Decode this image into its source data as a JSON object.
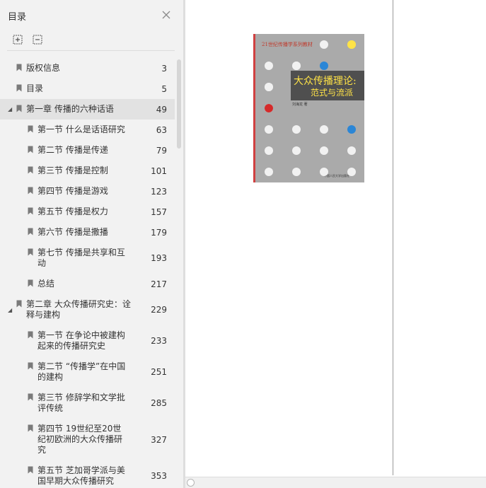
{
  "toc": {
    "title": "目录",
    "items": [
      {
        "label": "版权信息",
        "page": "3",
        "level": 1,
        "caret": "",
        "selected": false
      },
      {
        "label": "目录",
        "page": "5",
        "level": 1,
        "caret": "",
        "selected": false
      },
      {
        "label": "第一章 传播的六种话语",
        "page": "49",
        "level": 1,
        "caret": "◢",
        "selected": true
      },
      {
        "label": "第一节 什么是话语研究",
        "page": "63",
        "level": 2,
        "caret": "",
        "selected": false
      },
      {
        "label": "第二节 传播是传递",
        "page": "79",
        "level": 2,
        "caret": "",
        "selected": false
      },
      {
        "label": "第三节 传播是控制",
        "page": "101",
        "level": 2,
        "caret": "",
        "selected": false
      },
      {
        "label": "第四节 传播是游戏",
        "page": "123",
        "level": 2,
        "caret": "",
        "selected": false
      },
      {
        "label": "第五节 传播是权力",
        "page": "157",
        "level": 2,
        "caret": "",
        "selected": false
      },
      {
        "label": "第六节 传播是撒播",
        "page": "179",
        "level": 2,
        "caret": "",
        "selected": false
      },
      {
        "label": "第七节 传播是共享和互动",
        "page": "193",
        "level": 2,
        "caret": "",
        "selected": false
      },
      {
        "label": "总结",
        "page": "217",
        "level": 2,
        "caret": "",
        "selected": false
      },
      {
        "label": "第二章 大众传播研究史：诠释与建构",
        "page": "229",
        "level": 1,
        "caret": "◢",
        "selected": false
      },
      {
        "label": "第一节 在争论中被建构起来的传播研究史",
        "page": "233",
        "level": 2,
        "caret": "",
        "selected": false
      },
      {
        "label": "第二节 “传播学”在中国的建构",
        "page": "251",
        "level": 2,
        "caret": "",
        "selected": false
      },
      {
        "label": "第三节 修辞学和文学批评传统",
        "page": "285",
        "level": 2,
        "caret": "",
        "selected": false
      },
      {
        "label": "第四节 19世纪至20世纪初欧洲的大众传播研究",
        "page": "327",
        "level": 2,
        "caret": "",
        "selected": false
      },
      {
        "label": "第五节 芝加哥学派与美国早期大众传播研究",
        "page": "353",
        "level": 2,
        "caret": "",
        "selected": false
      }
    ]
  },
  "cover": {
    "series": "21世纪传播学系列教材",
    "title": "大众传播理论:",
    "subtitle": "范式与流派",
    "author": "刘海龙 著",
    "publisher": "中国人民大学出版社",
    "dot_colors": {
      "default": "#f1f1f1",
      "yellow": "#ffe347",
      "blue": "#2b86d6",
      "red": "#d42a2a"
    }
  },
  "icons": {
    "close": "close-icon",
    "expand_all": "expand-all-icon",
    "collapse_all": "collapse-all-icon",
    "bookmark": "bookmark-icon"
  }
}
